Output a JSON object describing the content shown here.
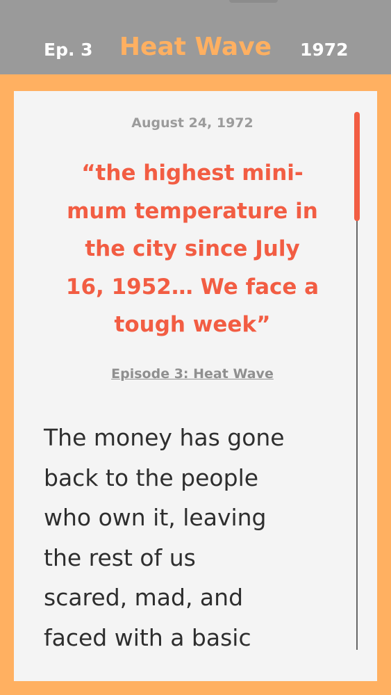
{
  "header": {
    "episode_label": "Ep. 3",
    "title": "Heat Wave",
    "year": "1972"
  },
  "article": {
    "date": "August 24, 1972",
    "quote_lines": [
      "“the highest mini-",
      "mum temperature in",
      "the city since July",
      "16, 1952… We face a",
      "tough week”"
    ],
    "episode_link": "Episode 3:  Heat Wave",
    "body_lines": [
      "The money has gone",
      "back to the people",
      "who own it, leaving",
      "the rest of us",
      "scared, mad, and",
      "faced with a basic"
    ]
  },
  "scroll": {
    "position_fraction": 0.0,
    "visible_fraction": 0.2
  },
  "colors": {
    "background": "#ffb061",
    "header": "#9a9a9a",
    "accent": "#f25d43",
    "card": "#f4f4f4"
  }
}
